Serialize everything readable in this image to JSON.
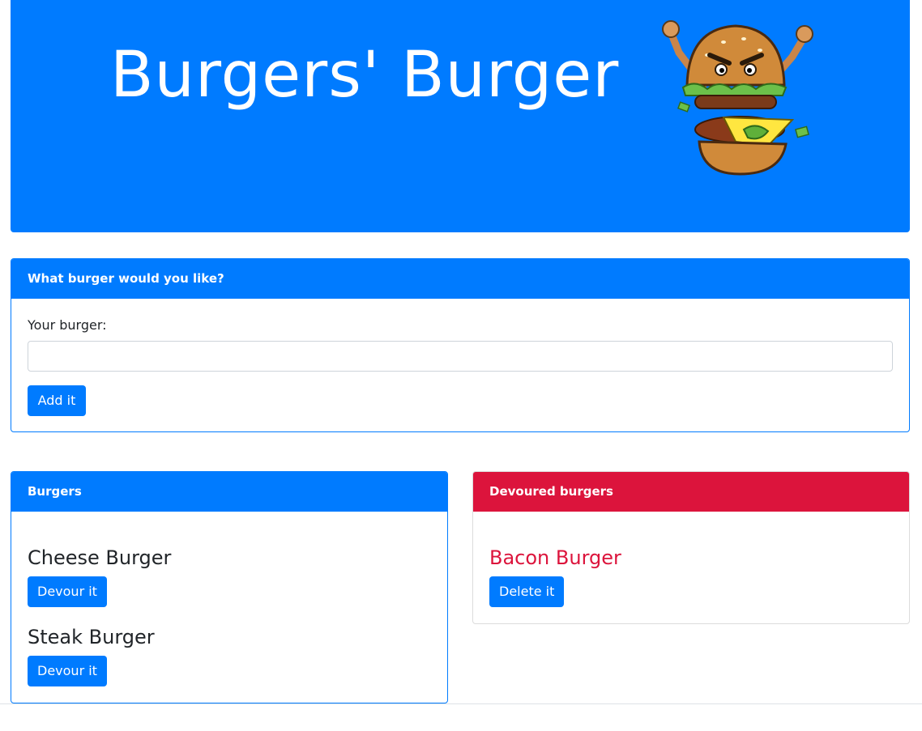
{
  "header": {
    "title": "Burgers' Burger"
  },
  "order_form": {
    "heading": "What burger would you like?",
    "label": "Your burger:",
    "input_value": "",
    "submit_label": "Add it"
  },
  "burgers": {
    "heading": "Burgers",
    "items": [
      {
        "name": "Cheese Burger",
        "action": "Devour it"
      },
      {
        "name": "Steak Burger",
        "action": "Devour it"
      }
    ]
  },
  "devoured": {
    "heading": "Devoured burgers",
    "items": [
      {
        "name": "Bacon Burger",
        "action": "Delete it"
      }
    ]
  },
  "colors": {
    "primary": "#007bff",
    "danger": "#dc143c"
  },
  "icons": {
    "mascot": "burger-mascot-icon"
  }
}
